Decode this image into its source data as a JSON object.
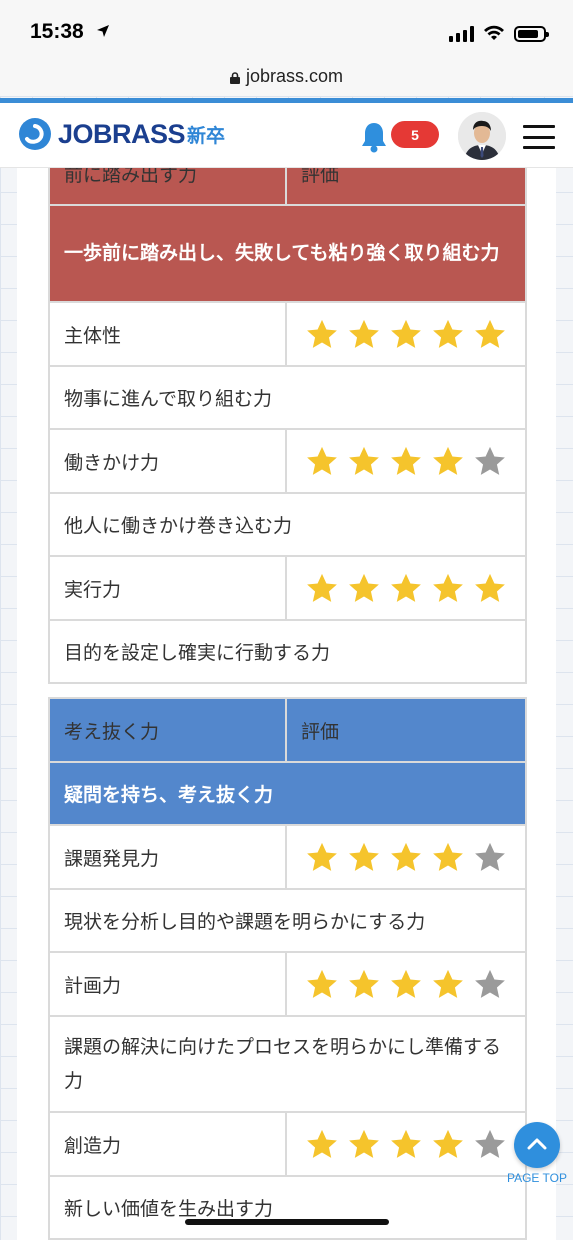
{
  "status_bar": {
    "time": "15:38"
  },
  "browser": {
    "url": "jobrass.com"
  },
  "header": {
    "logo_text": "JOBRASS",
    "logo_sub": "新卒",
    "notification_count": "5"
  },
  "table_red": {
    "col_skill": "前に踏み出す力",
    "col_rating": "評価",
    "description": "一歩前に踏み出し、失敗しても粘り強く取り組む力",
    "rows": [
      {
        "skill": "主体性",
        "stars": 5,
        "desc": "物事に進んで取り組む力"
      },
      {
        "skill": "働きかけ力",
        "stars": 4,
        "desc": "他人に働きかけ巻き込む力"
      },
      {
        "skill": "実行力",
        "stars": 5,
        "desc": "目的を設定し確実に行動する力"
      }
    ]
  },
  "table_blue": {
    "col_skill": "考え抜く力",
    "col_rating": "評価",
    "description": "疑問を持ち、考え抜く力",
    "rows": [
      {
        "skill": "課題発見力",
        "stars": 4,
        "desc": "現状を分析し目的や課題を明らかにする力"
      },
      {
        "skill": "計画力",
        "stars": 4,
        "desc": "課題の解決に向けたプロセスを明らかにし準備する力"
      },
      {
        "skill": "創造力",
        "stars": 4,
        "desc": "新しい価値を生み出す力"
      }
    ]
  },
  "rating_max": 5,
  "page_top_label": "PAGE TOP",
  "colors": {
    "red_header": "#b95751",
    "blue_header": "#5387cc",
    "star_on": "#f5c42c",
    "star_off": "#9a9a9a",
    "accent": "#3b8dd6"
  }
}
